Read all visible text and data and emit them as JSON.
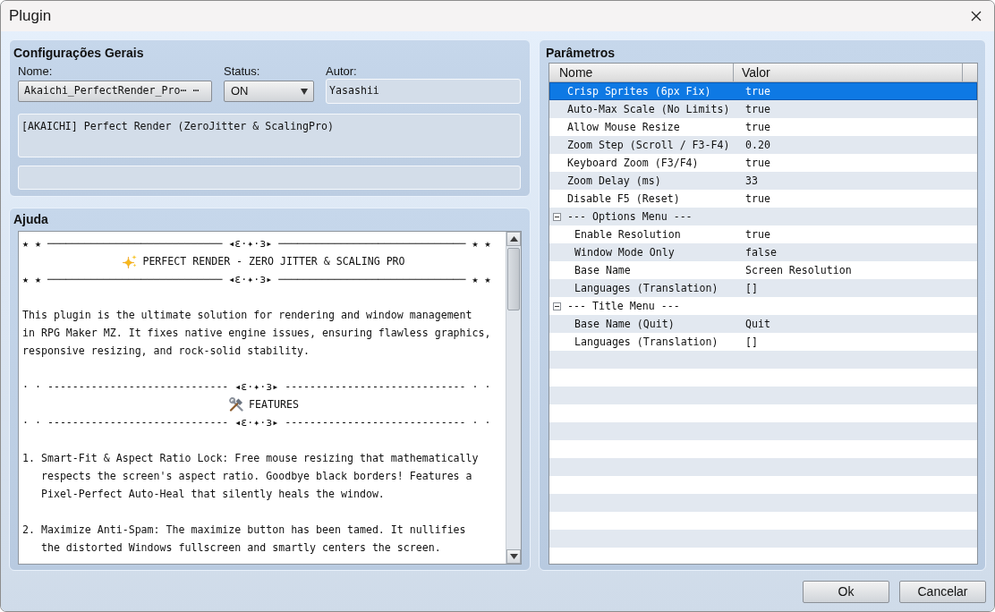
{
  "window": {
    "title": "Plugin"
  },
  "general": {
    "title": "Configurações Gerais",
    "name_label": "Nome:",
    "name_value": "Akaichi_PerfectRender_Pro⋯ ⋯",
    "status_label": "Status:",
    "status_value": "ON",
    "author_label": "Autor:",
    "author_value": "Yasashii",
    "description": "[AKAICHI] Perfect Render (ZeroJitter & ScalingPro)"
  },
  "help": {
    "title": "Ajuda",
    "blocks": [
      {
        "kind": "ornament",
        "text": "★ ★ ──────────────────────────── ◂ɛ·✦·ɜ▸ ────────────────────────────── ★ ★"
      },
      {
        "kind": "heading",
        "text": "PERFECT RENDER - ZERO JITTER & SCALING PRO"
      },
      {
        "kind": "ornament",
        "text": "★ ★ ──────────────────────────── ◂ɛ·✦·ɜ▸ ────────────────────────────── ★ ★"
      },
      {
        "kind": "paragraph",
        "text": "This plugin is the ultimate solution for rendering and window management\nin RPG Maker MZ. It fixes native engine issues, ensuring flawless graphics,\nresponsive resizing, and rock-solid stability."
      },
      {
        "kind": "ornament",
        "text": "· · ----------------------------- ◂ɛ·✦·ɜ▸ ----------------------------- · ·"
      },
      {
        "kind": "heading",
        "text": "FEATURES"
      },
      {
        "kind": "ornament",
        "text": "· · ----------------------------- ◂ɛ·✦·ɜ▸ ----------------------------- · ·"
      },
      {
        "kind": "list_item",
        "text": "1. Smart-Fit & Aspect Ratio Lock: Free mouse resizing that mathematically\n   respects the screen's aspect ratio. Goodbye black borders! Features a\n   Pixel-Perfect Auto-Heal that silently heals the window."
      },
      {
        "kind": "list_item",
        "text": "2. Maximize Anti-Spam: The maximize button has been tamed. It nullifies\n   the distorted Windows fullscreen and smartly centers the screen."
      }
    ]
  },
  "parameters": {
    "title": "Parâmetros",
    "columns": [
      "Nome",
      "Valor"
    ],
    "rows": [
      {
        "name": "Crisp Sprites (6px Fix)",
        "value": "true",
        "selected": true
      },
      {
        "name": "Auto-Max Scale (No Limits)",
        "value": "true",
        "selected": false
      },
      {
        "name": "Allow Mouse Resize",
        "value": "true",
        "selected": false
      },
      {
        "name": "Zoom Step (Scroll / F3-F4)",
        "value": "0.20",
        "selected": false
      },
      {
        "name": "Keyboard Zoom (F3/F4)",
        "value": "true",
        "selected": false
      },
      {
        "name": "Zoom Delay (ms)",
        "value": "33",
        "selected": false
      },
      {
        "name": "Disable F5 (Reset)",
        "value": "true",
        "selected": false
      },
      {
        "name": "--- Options Menu ---",
        "selected": false,
        "expanded": true,
        "children": [
          {
            "name": "Enable Resolution",
            "value": "true",
            "selected": false
          },
          {
            "name": "Window Mode Only",
            "value": "false",
            "selected": false
          },
          {
            "name": "Base Name",
            "value": "Screen Resolution",
            "selected": false
          },
          {
            "name": "Languages (Translation)",
            "value": "[]",
            "selected": false
          }
        ]
      },
      {
        "name": "--- Title Menu ---",
        "selected": false,
        "expanded": true,
        "children": [
          {
            "name": "Base Name (Quit)",
            "value": "Quit",
            "selected": false
          },
          {
            "name": "Languages (Translation)",
            "value": "[]",
            "selected": false
          }
        ]
      }
    ]
  },
  "buttons": [
    "Ok",
    "Cancelar"
  ]
}
